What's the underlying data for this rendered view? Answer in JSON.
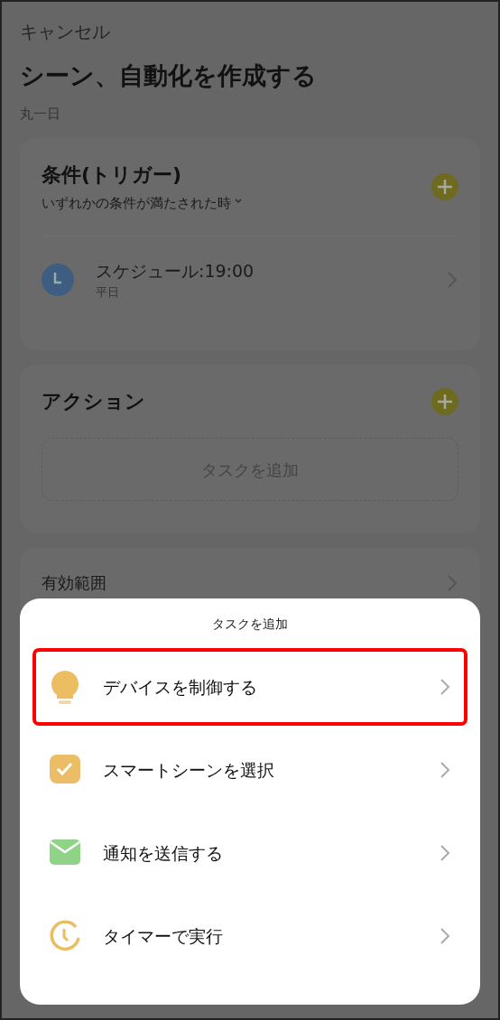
{
  "header": {
    "cancel": "キャンセル",
    "title": "シーン、自動化を作成する",
    "subtitle": "丸一日"
  },
  "conditions": {
    "title": "条件(トリガー)",
    "mode": "いずれかの条件が満たされた時",
    "items": [
      {
        "title": "スケジュール:19:00",
        "subtitle": "平日"
      }
    ]
  },
  "actions": {
    "title": "アクション",
    "add_task": "タスクを追加"
  },
  "scope": {
    "label": "有効範囲"
  },
  "sheet": {
    "title": "タスクを追加",
    "options": [
      {
        "kind": "bulb",
        "label": "デバイスを制御する",
        "highlighted": true
      },
      {
        "kind": "check",
        "label": "スマートシーンを選択",
        "highlighted": false
      },
      {
        "kind": "mail",
        "label": "通知を送信する",
        "highlighted": false
      },
      {
        "kind": "timer",
        "label": "タイマーで実行",
        "highlighted": false
      }
    ]
  }
}
